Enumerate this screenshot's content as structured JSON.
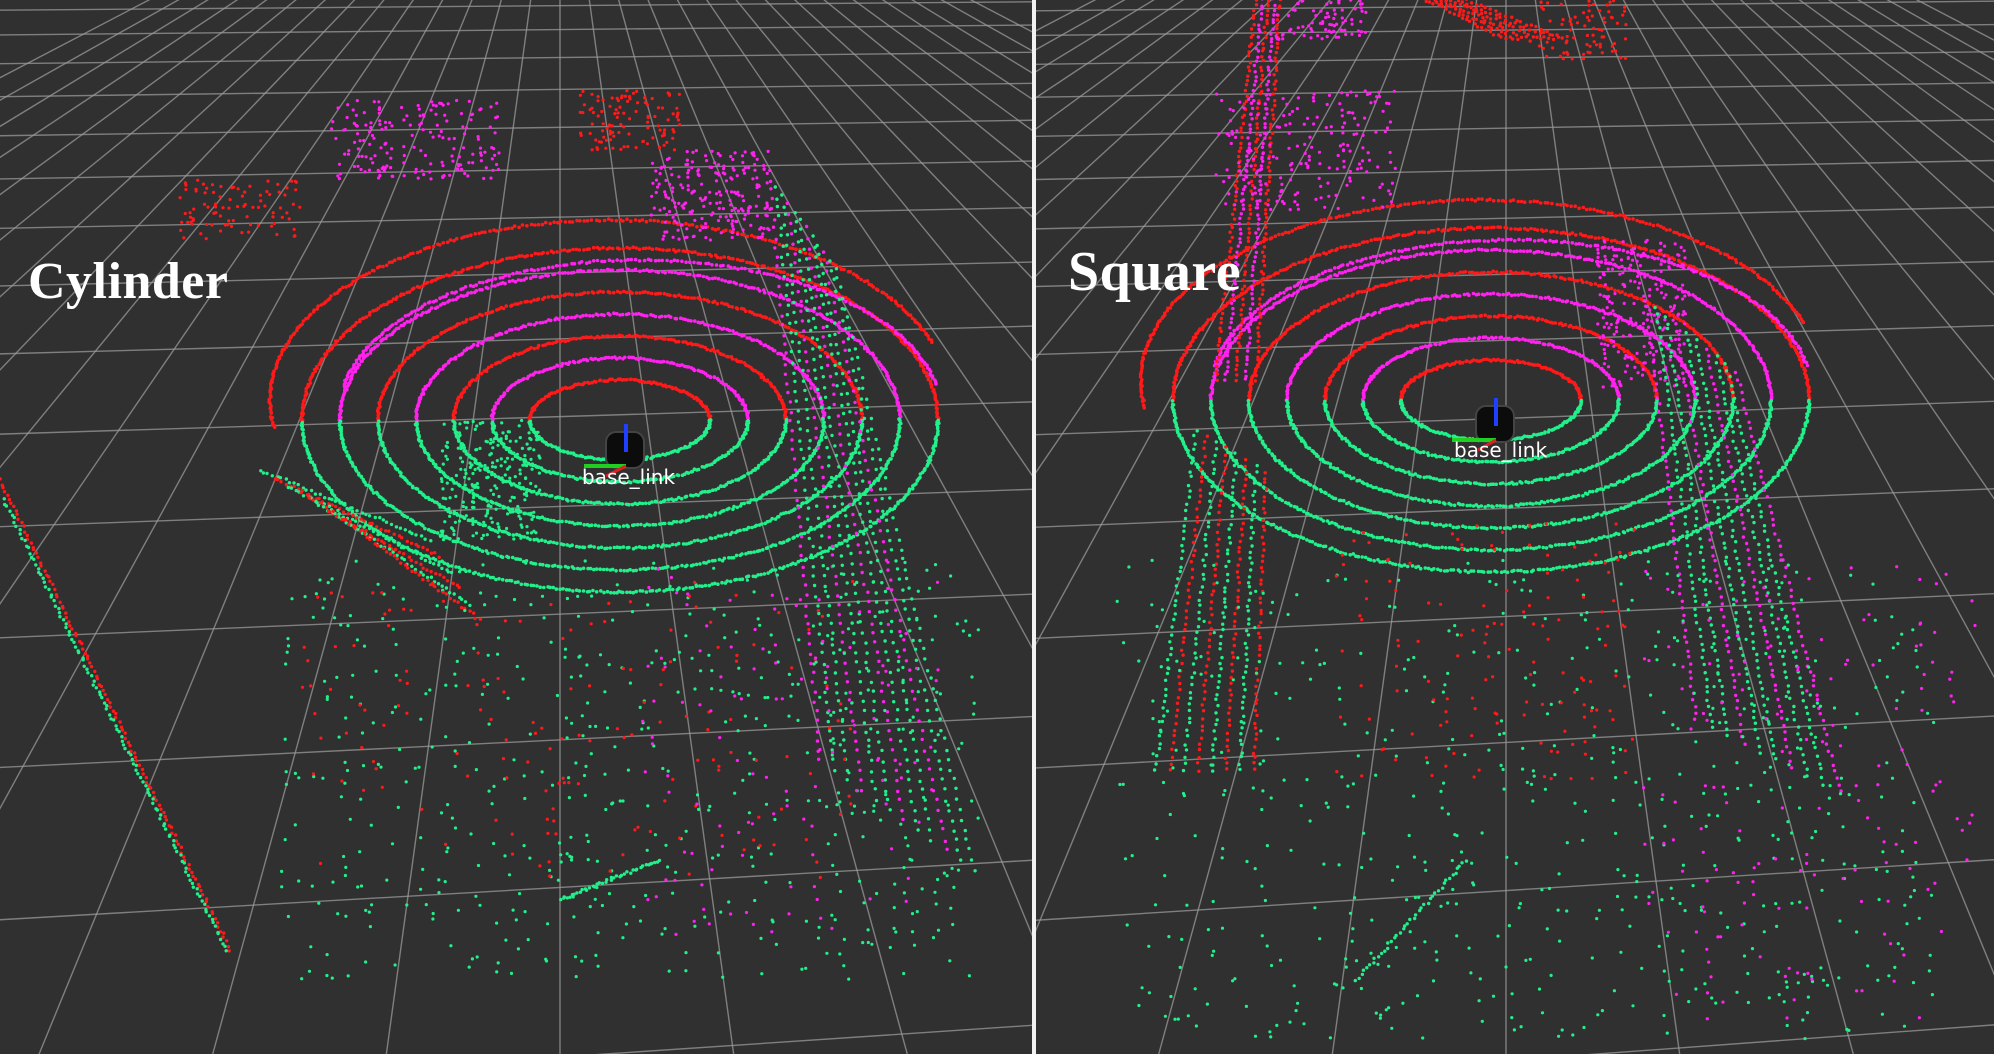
{
  "panels": [
    {
      "title": "Cylinder",
      "frame_label": "base_link"
    },
    {
      "title": "Square",
      "frame_label": "base_link"
    }
  ],
  "colors": {
    "background": "#303030",
    "grid": "#9a9a9a",
    "points_near": "#ff1a1a",
    "points_mid": "#ff22ee",
    "points_far": "#22f08a",
    "axis_x": "#e02020",
    "axis_y": "#20d020",
    "axis_z": "#2040ff"
  }
}
